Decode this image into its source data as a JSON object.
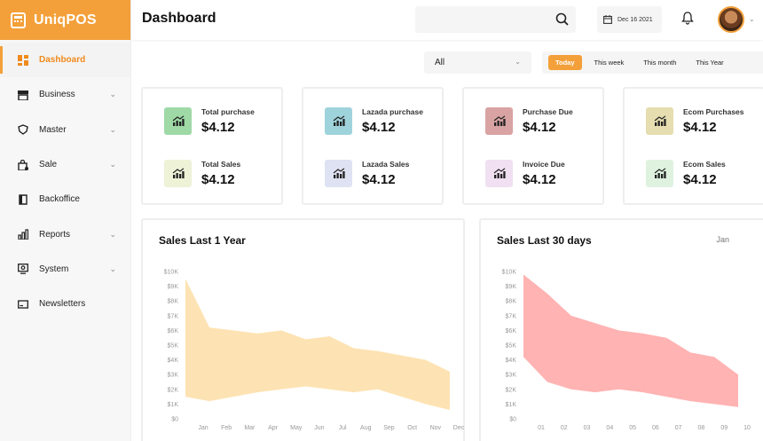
{
  "app": {
    "name": "UniqPOS"
  },
  "sidebar": {
    "items": [
      {
        "label": "Dashboard",
        "icon": "grid-icon",
        "active": true,
        "chevron": false
      },
      {
        "label": "Business",
        "icon": "store-icon",
        "chevron": true
      },
      {
        "label": "Master",
        "icon": "shield-icon",
        "chevron": true
      },
      {
        "label": "Sale",
        "icon": "bag-icon",
        "chevron": true
      },
      {
        "label": "Backoffice",
        "icon": "book-icon",
        "chevron": true
      },
      {
        "label": "Reports",
        "icon": "bar-chart-icon",
        "chevron": true
      },
      {
        "label": "System",
        "icon": "monitor-gear-icon",
        "chevron": true
      },
      {
        "label": "Newsletters",
        "icon": "mail-icon",
        "chevron": false
      }
    ]
  },
  "header": {
    "title": "Dashboard",
    "search_placeholder": "",
    "date": "Dec 16 2021"
  },
  "filters": {
    "select_value": "All",
    "ranges": [
      "Today",
      "This week",
      "This month",
      "This Year"
    ],
    "active_range": "Today"
  },
  "stats": [
    [
      {
        "label": "Total purchase",
        "value": "$4.12",
        "color": "#9ed9a6"
      },
      {
        "label": "Total Sales",
        "value": "$4.12",
        "color": "#eef2d7"
      }
    ],
    [
      {
        "label": "Lazada purchase",
        "value": "$4.12",
        "color": "#9fd3dc"
      },
      {
        "label": "Lazada Sales",
        "value": "$4.12",
        "color": "#dfe2f2"
      }
    ],
    [
      {
        "label": "Purchase Due",
        "value": "$4.12",
        "color": "#d9a3a3"
      },
      {
        "label": "Invoice Due",
        "value": "$4.12",
        "color": "#f0e0f2"
      }
    ],
    [
      {
        "label": "Ecom Purchases",
        "value": "$4.12",
        "color": "#e6ddb0"
      },
      {
        "label": "Ecom Sales",
        "value": "$4.12",
        "color": "#dff2e0"
      }
    ]
  ],
  "chart_data": [
    {
      "type": "area",
      "title": "Sales Last 1 Year",
      "color": "#fde3b3",
      "x_ticks": [
        "Jan",
        "Feb",
        "Mar",
        "Apr",
        "May",
        "Jun",
        "Jul",
        "Aug",
        "Sep",
        "Oct",
        "Nov",
        "Dec"
      ],
      "y_ticks": [
        "$10K",
        "$9K",
        "$8K",
        "$7K",
        "$6K",
        "$5K",
        "$4K",
        "$3K",
        "$2K",
        "$1K",
        "$0"
      ],
      "ylim": [
        0,
        10000
      ],
      "x": [
        "Jan",
        "Feb",
        "Mar",
        "Apr",
        "May",
        "Jun",
        "Jul",
        "Aug",
        "Sep",
        "Oct",
        "Nov",
        "Dec"
      ],
      "upper": [
        9500,
        6200,
        6000,
        5800,
        6000,
        5400,
        5600,
        4800,
        4600,
        4300,
        4000,
        3200
      ],
      "lower": [
        1500,
        1200,
        1500,
        1800,
        2000,
        2200,
        2000,
        1800,
        2000,
        1500,
        1000,
        600
      ]
    },
    {
      "type": "area",
      "title": "Sales Last 30 days",
      "subtitle": "Jan",
      "color": "#ffb3b3",
      "x_ticks": [
        "01",
        "02",
        "03",
        "04",
        "05",
        "06",
        "07",
        "08",
        "09",
        "10"
      ],
      "y_ticks": [
        "$10K",
        "$9K",
        "$8K",
        "$7K",
        "$6K",
        "$5K",
        "$4K",
        "$3K",
        "$2K",
        "$1K",
        "$0"
      ],
      "ylim": [
        0,
        10000
      ],
      "x": [
        "01",
        "02",
        "03",
        "04",
        "05",
        "06",
        "07",
        "08",
        "09",
        "10"
      ],
      "upper": [
        9800,
        8500,
        7000,
        6500,
        6000,
        5800,
        5500,
        4500,
        4200,
        3000
      ],
      "lower": [
        4200,
        2500,
        2000,
        1800,
        2000,
        1800,
        1500,
        1200,
        1000,
        800
      ]
    }
  ]
}
